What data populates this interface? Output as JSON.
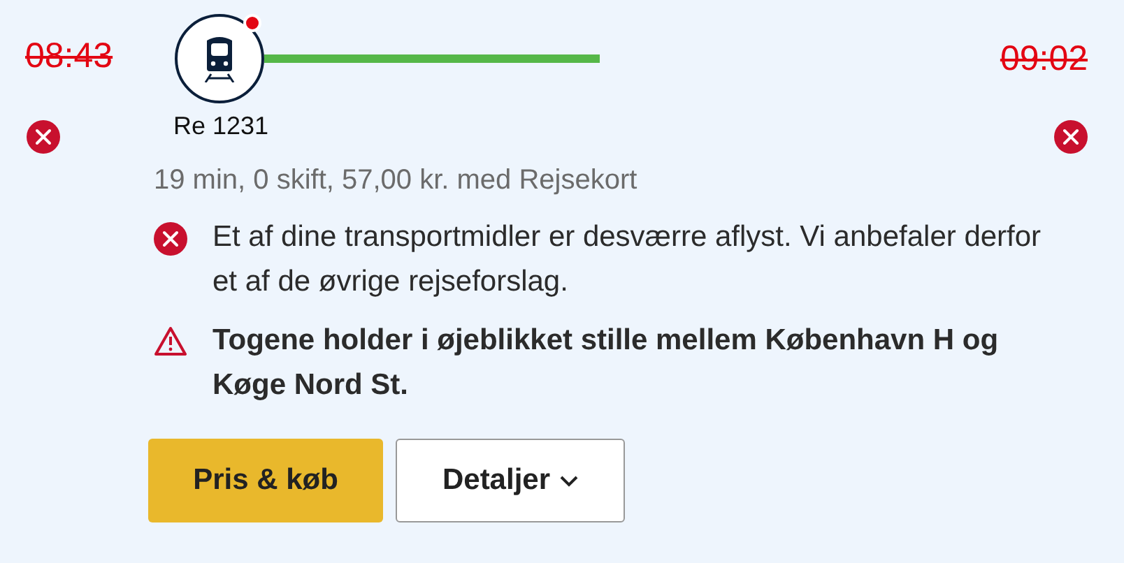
{
  "departure": {
    "time": "08:43",
    "cancelled": true
  },
  "arrival": {
    "time": "09:02",
    "cancelled": true
  },
  "leg": {
    "train": "Re 1231",
    "alert": true
  },
  "summary": "19 min, 0 skift, 57,00 kr. med Rejsekort",
  "messages": [
    {
      "kind": "error",
      "text": "Et af dine transportmidler er desværre aflyst. Vi anbefaler derfor et af de øvrige rejseforslag."
    },
    {
      "kind": "warning",
      "text": "Togene holder i øjeblikket stille mellem København H og Køge Nord St."
    }
  ],
  "buttons": [
    {
      "kind": "primary",
      "label": "Pris & køb"
    },
    {
      "kind": "dropdown",
      "label": "Detaljer"
    }
  ]
}
